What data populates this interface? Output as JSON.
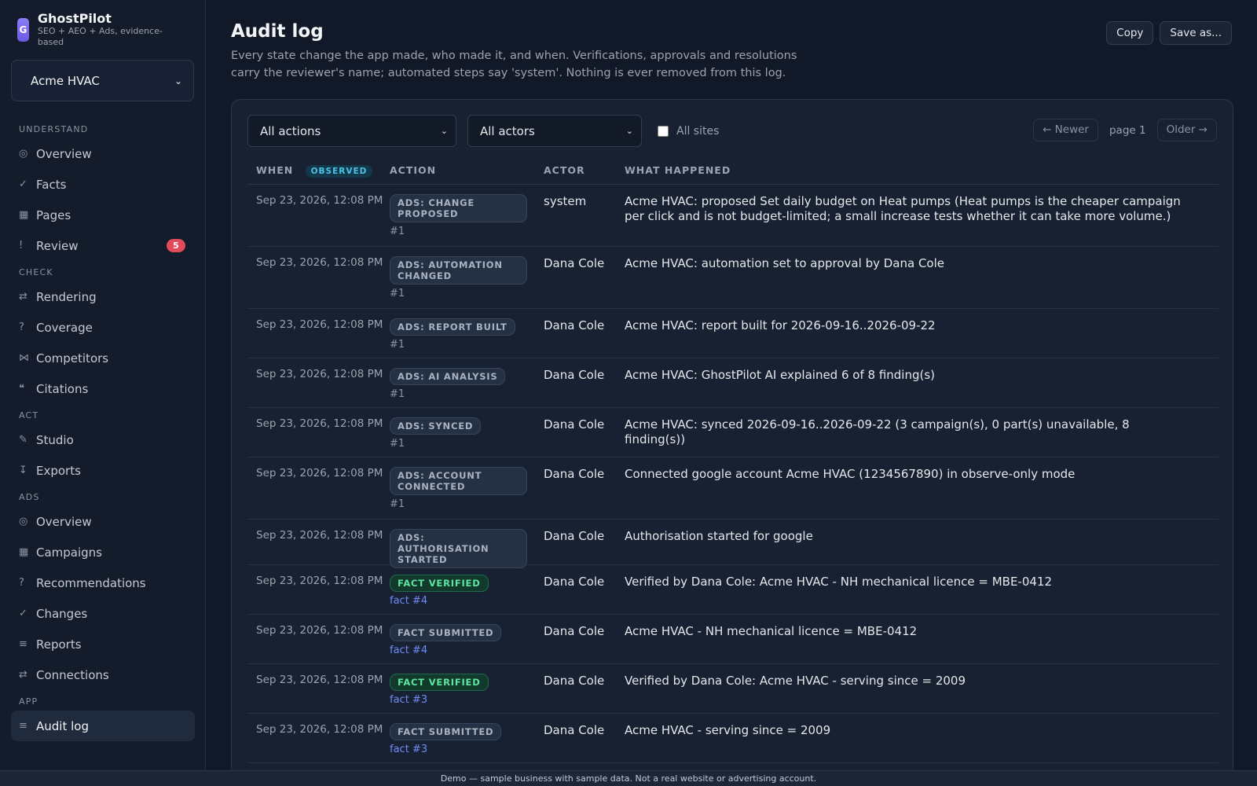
{
  "brand": {
    "logo_letter": "G",
    "name": "GhostPilot",
    "tagline": "SEO + AEO + Ads, evidence-based"
  },
  "site_select": {
    "value": "Acme HVAC"
  },
  "sidebar": {
    "sections": [
      {
        "title": "UNDERSTAND",
        "items": [
          {
            "icon": "◎",
            "icon_name": "overview-icon",
            "label": "Overview"
          },
          {
            "icon": "✓",
            "icon_name": "check-icon",
            "label": "Facts"
          },
          {
            "icon": "▦",
            "icon_name": "pages-icon",
            "label": "Pages"
          },
          {
            "icon": "!",
            "icon_name": "alert-icon",
            "label": "Review",
            "badge": "5"
          }
        ]
      },
      {
        "title": "CHECK",
        "items": [
          {
            "icon": "⇄",
            "icon_name": "rendering-icon",
            "label": "Rendering"
          },
          {
            "icon": "?",
            "icon_name": "question-icon",
            "label": "Coverage"
          },
          {
            "icon": "⋈",
            "icon_name": "compare-icon",
            "label": "Competitors"
          },
          {
            "icon": "❝",
            "icon_name": "quote-icon",
            "label": "Citations"
          }
        ]
      },
      {
        "title": "ACT",
        "items": [
          {
            "icon": "✎",
            "icon_name": "pencil-icon",
            "label": "Studio"
          },
          {
            "icon": "↧",
            "icon_name": "download-icon",
            "label": "Exports"
          }
        ]
      },
      {
        "title": "ADS",
        "items": [
          {
            "icon": "◎",
            "icon_name": "overview-icon",
            "label": "Overview"
          },
          {
            "icon": "▦",
            "icon_name": "campaigns-icon",
            "label": "Campaigns"
          },
          {
            "icon": "?",
            "icon_name": "question-icon",
            "label": "Recommendations"
          },
          {
            "icon": "✓",
            "icon_name": "check-icon",
            "label": "Changes"
          },
          {
            "icon": "≡",
            "icon_name": "list-icon",
            "label": "Reports"
          },
          {
            "icon": "⇄",
            "icon_name": "connections-icon",
            "label": "Connections"
          }
        ]
      },
      {
        "title": "APP",
        "items": [
          {
            "icon": "≡",
            "icon_name": "list-icon",
            "label": "Audit log",
            "active": true
          }
        ]
      }
    ]
  },
  "page": {
    "title": "Audit log",
    "description": "Every state change the app made, who made it, and when. Verifications, approvals and resolutions carry the reviewer's name; automated steps say 'system'. Nothing is ever removed from this log.",
    "copy_label": "Copy",
    "save_label": "Save as..."
  },
  "filters": {
    "actions": "All actions",
    "actors": "All actors",
    "all_sites": "All sites",
    "newer": "← Newer",
    "page": "page 1",
    "older": "Older →"
  },
  "table": {
    "headers": {
      "when": "WHEN",
      "observed": "OBSERVED",
      "action": "ACTION",
      "actor": "ACTOR",
      "what": "WHAT HAPPENED"
    },
    "rows": [
      {
        "when": "Sep 23, 2026, 12:08 PM",
        "action": "ADS: CHANGE PROPOSED",
        "ref": "#1",
        "actor": "system",
        "what": "Acme HVAC: proposed Set daily budget on Heat pumps (Heat pumps is the cheaper campaign per click and is not budget-limited; a small increase tests whether it can take more volume.)"
      },
      {
        "when": "Sep 23, 2026, 12:08 PM",
        "action": "ADS: AUTOMATION CHANGED",
        "ref": "#1",
        "actor": "Dana Cole",
        "what": "Acme HVAC: automation set to approval by Dana Cole"
      },
      {
        "when": "Sep 23, 2026, 12:08 PM",
        "action": "ADS: REPORT BUILT",
        "ref": "#1",
        "actor": "Dana Cole",
        "what": "Acme HVAC: report built for 2026-09-16..2026-09-22"
      },
      {
        "when": "Sep 23, 2026, 12:08 PM",
        "action": "ADS: AI ANALYSIS",
        "ref": "#1",
        "actor": "Dana Cole",
        "what": "Acme HVAC: GhostPilot AI explained 6 of 8 finding(s)"
      },
      {
        "when": "Sep 23, 2026, 12:08 PM",
        "action": "ADS: SYNCED",
        "ref": "#1",
        "actor": "Dana Cole",
        "what": "Acme HVAC: synced 2026-09-16..2026-09-22 (3 campaign(s), 0 part(s) unavailable, 8 finding(s))"
      },
      {
        "when": "Sep 23, 2026, 12:08 PM",
        "action": "ADS: ACCOUNT CONNECTED",
        "ref": "#1",
        "actor": "Dana Cole",
        "what": "Connected google account Acme HVAC (1234567890) in observe-only mode"
      },
      {
        "when": "Sep 23, 2026, 12:08 PM",
        "action": "ADS: AUTHORISATION STARTED",
        "ref": "",
        "actor": "Dana Cole",
        "what": "Authorisation started for google"
      },
      {
        "when": "Sep 23, 2026, 12:08 PM",
        "action": "FACT VERIFIED",
        "ref": "fact #4",
        "ref_link": true,
        "green": true,
        "actor": "Dana Cole",
        "what": "Verified by Dana Cole: Acme HVAC - NH mechanical licence = MBE-0412"
      },
      {
        "when": "Sep 23, 2026, 12:08 PM",
        "action": "FACT SUBMITTED",
        "ref": "fact #4",
        "ref_link": true,
        "actor": "Dana Cole",
        "what": "Acme HVAC - NH mechanical licence = MBE-0412"
      },
      {
        "when": "Sep 23, 2026, 12:08 PM",
        "action": "FACT VERIFIED",
        "ref": "fact #3",
        "ref_link": true,
        "green": true,
        "actor": "Dana Cole",
        "what": "Verified by Dana Cole: Acme HVAC - serving since = 2009"
      },
      {
        "when": "Sep 23, 2026, 12:08 PM",
        "action": "FACT SUBMITTED",
        "ref": "fact #3",
        "ref_link": true,
        "actor": "Dana Cole",
        "what": "Acme HVAC - serving since = 2009"
      }
    ]
  },
  "footer": "Demo — sample business with sample data. Not a real website or advertising account.",
  "colors": {
    "accent": "#7c6cf0",
    "badge_red": "#e04a5a",
    "verified_green": "#5ee6a0",
    "link_blue": "#6f8cf5"
  }
}
